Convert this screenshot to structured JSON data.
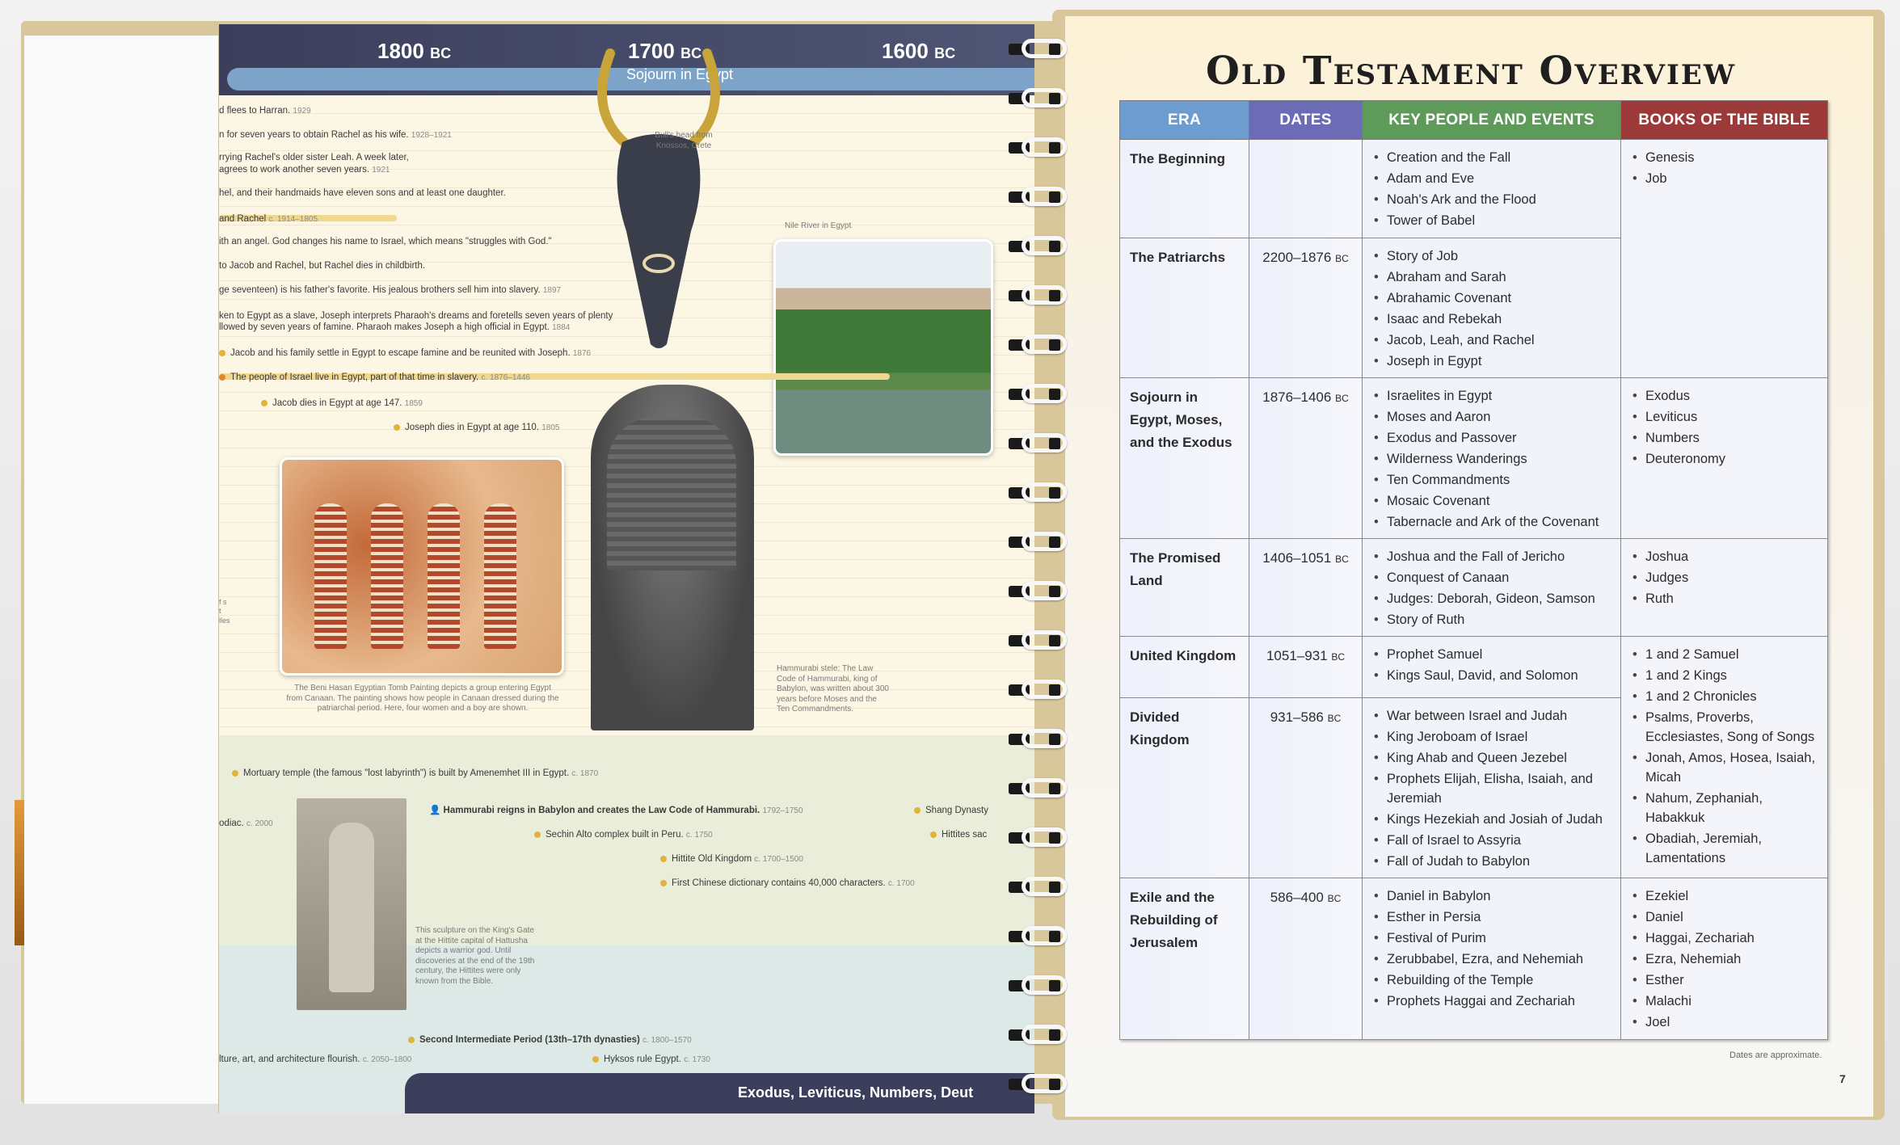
{
  "timeline": {
    "years": [
      "1800",
      "1700",
      "1600"
    ],
    "era_suffix": "BC",
    "band_label": "Sojourn in Egypt",
    "events": [
      {
        "text": "d flees to Harran.",
        "date": "1929"
      },
      {
        "text": "n for seven years to obtain Rachel as his wife.",
        "date": "1928–1921"
      },
      {
        "text": "rrying Rachel's older sister Leah. A week later,",
        "date": ""
      },
      {
        "text": "agrees to work another seven years.",
        "date": "1921"
      },
      {
        "text": "hel, and their handmaids have eleven sons and at least one daughter.",
        "date": ""
      },
      {
        "text": "and Rachel",
        "date": "c. 1914–1805"
      },
      {
        "text": "ith an angel. God changes his name to Israel, which means \"struggles with God.\"",
        "date": ""
      },
      {
        "text": "to Jacob and Rachel, but Rachel dies in childbirth.",
        "date": ""
      },
      {
        "text": "ge seventeen) is his father's favorite. His jealous brothers sell him into slavery.",
        "date": "1897"
      },
      {
        "text": "ken to Egypt as a slave, Joseph interprets Pharaoh's dreams and foretells seven years of plenty",
        "date": ""
      },
      {
        "text": "llowed by seven years of famine. Pharaoh makes Joseph a high official in Egypt.",
        "date": "1884"
      },
      {
        "text": "Jacob and his family settle in Egypt to escape famine and be reunited with Joseph.",
        "date": "1876"
      },
      {
        "text": "The people of Israel live in Egypt, part of that time in slavery.",
        "date": "c. 1876–1446"
      },
      {
        "text": "Jacob dies in Egypt at age 147.",
        "date": "1859"
      },
      {
        "text": "Joseph dies in Egypt at age 110.",
        "date": "1805"
      },
      {
        "text": "Mortuary temple (the famous \"lost labyrinth\") is built by Amenemhet III in Egypt.",
        "date": "c. 1870"
      },
      {
        "text": "Hammurabi reigns in Babylon and creates the Law Code of Hammurabi.",
        "date": "1792–1750"
      },
      {
        "text": "Sechin Alto complex built in Peru.",
        "date": "c. 1750"
      },
      {
        "text": "Hittite Old Kingdom",
        "date": "c. 1700–1500"
      },
      {
        "text": "First Chinese dictionary contains 40,000 characters.",
        "date": "c. 1700"
      },
      {
        "text": "Shang Dynasty",
        "date": ""
      },
      {
        "text": "Hittites sac",
        "date": ""
      },
      {
        "text": "odiac.",
        "date": "c. 2000"
      },
      {
        "text": "Second Intermediate Period (13th–17th dynasties)",
        "date": "c. 1800–1570"
      },
      {
        "text": "Hyksos rule Egypt.",
        "date": "c. 1730"
      },
      {
        "text": "lture, art, and architecture flourish.",
        "date": "c. 2050–1800"
      }
    ],
    "captions": {
      "bull": "Bull's head from Knossos, Crete",
      "nile": "Nile River in Egypt",
      "tomb": "The Beni Hasan Egyptian Tomb Painting depicts a group entering Egypt from Canaan. The painting shows how people in Canaan dressed during the patriarchal period. Here, four women and a boy are shown.",
      "stele": "Hammurabi stele: The Law Code of Hammurabi, king of Babylon, was written about 300 years before Moses and the Ten Commandments.",
      "sculpture": "This sculpture on the King's Gate at the Hittite capital of Hattusha depicts a warrior god. Until discoveries at the end of the 19th century, the Hittites were only known from the Bible.",
      "margin": "f s t lles"
    },
    "bottom_bar": "Exodus, Leviticus, Numbers, Deut"
  },
  "overview": {
    "title": "Old Testament Overview",
    "headers": {
      "era": "ERA",
      "dates": "DATES",
      "key": "KEY PEOPLE AND EVENTS",
      "books": "BOOKS OF THE BIBLE"
    },
    "bc": "BC",
    "rows": [
      {
        "era": "The Beginning",
        "dates": "",
        "key": [
          "Creation and the Fall",
          "Adam and Eve",
          "Noah's Ark and the Flood",
          "Tower of Babel"
        ],
        "books": [
          "Genesis",
          "Job"
        ]
      },
      {
        "era": "The Patriarchs",
        "dates": "2200–1876",
        "key": [
          "Story of Job",
          "Abraham and Sarah",
          "Abrahamic Covenant",
          "Isaac and Rebekah",
          "Jacob, Leah, and Rachel",
          "Joseph in Egypt"
        ],
        "books": []
      },
      {
        "era": "Sojourn in Egypt, Moses, and the Exodus",
        "dates": "1876–1406",
        "key": [
          "Israelites in Egypt",
          "Moses and Aaron",
          "Exodus and Passover",
          "Wilderness Wanderings",
          "Ten Commandments",
          "Mosaic Covenant",
          "Tabernacle and Ark of the Covenant"
        ],
        "books": [
          "Exodus",
          "Leviticus",
          "Numbers",
          "Deuteronomy"
        ]
      },
      {
        "era": "The Promised Land",
        "dates": "1406–1051",
        "key": [
          "Joshua and the Fall of Jericho",
          "Conquest of Canaan",
          "Judges: Deborah, Gideon, Samson",
          "Story of Ruth"
        ],
        "books": [
          "Joshua",
          "Judges",
          "Ruth"
        ]
      },
      {
        "era": "United Kingdom",
        "dates": "1051–931",
        "key": [
          "Prophet Samuel",
          "Kings Saul, David, and Solomon"
        ],
        "books": [
          "1 and 2 Samuel",
          "1 and 2 Kings",
          "1 and 2 Chronicles",
          "Psalms, Proverbs, Ecclesiastes, Song of Songs",
          "Jonah, Amos, Hosea, Isaiah, Micah",
          "Nahum, Zephaniah, Habakkuk",
          "Obadiah, Jeremiah, Lamentations"
        ]
      },
      {
        "era": "Divided Kingdom",
        "dates": "931–586",
        "key": [
          "War between Israel and Judah",
          "King Jeroboam of Israel",
          "King Ahab and Queen Jezebel",
          "Prophets Elijah, Elisha, Isaiah, and Jeremiah",
          "Kings Hezekiah and Josiah of Judah",
          "Fall of Israel to Assyria",
          "Fall of Judah to Babylon"
        ],
        "books": []
      },
      {
        "era": "Exile and the Rebuilding of Jerusalem",
        "dates": "586–400",
        "key": [
          "Daniel in Babylon",
          "Esther in Persia",
          "Festival of Purim",
          "Zerubbabel, Ezra, and Nehemiah",
          "Rebuilding of the Temple",
          "Prophets Haggai and Zechariah"
        ],
        "books": [
          "Ezekiel",
          "Daniel",
          "Haggai, Zechariah",
          "Ezra, Nehemiah",
          "Esther",
          "Malachi",
          "Joel"
        ]
      }
    ],
    "footnote": "Dates are approximate.",
    "page_number": "7"
  }
}
